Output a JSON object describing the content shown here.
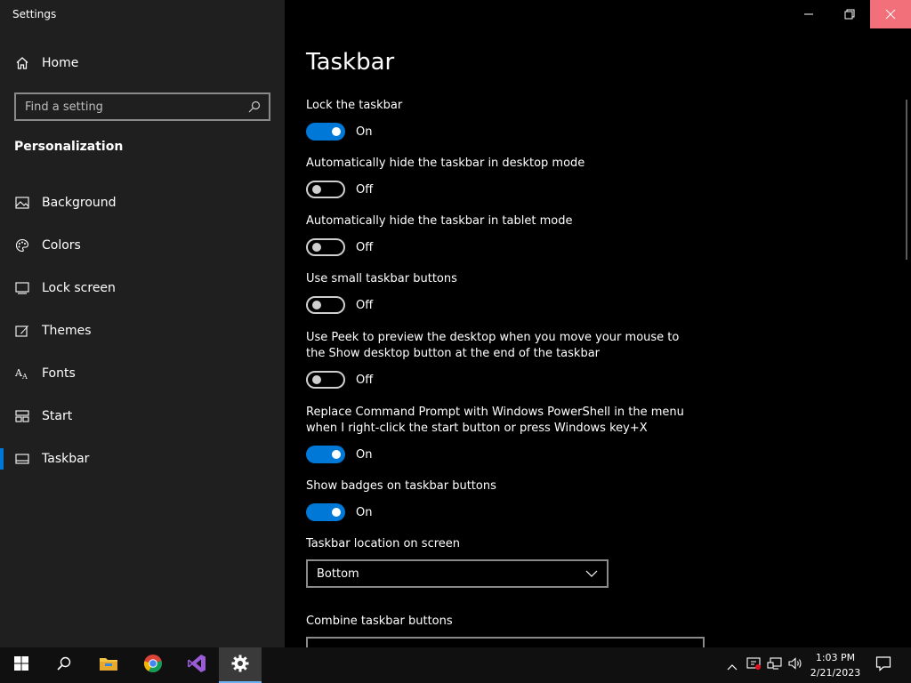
{
  "window": {
    "app_title": "Settings",
    "minimize_icon": "minimize-icon",
    "maximize_icon": "restore-icon",
    "close_icon": "close-icon",
    "close_hover_color": "#f1707a"
  },
  "sidebar": {
    "home_label": "Home",
    "search_placeholder": "Find a setting",
    "section_title": "Personalization",
    "items": [
      {
        "label": "Background",
        "icon": "picture-icon"
      },
      {
        "label": "Colors",
        "icon": "palette-icon"
      },
      {
        "label": "Lock screen",
        "icon": "lock-screen-icon"
      },
      {
        "label": "Themes",
        "icon": "themes-icon"
      },
      {
        "label": "Fonts",
        "icon": "fonts-icon"
      },
      {
        "label": "Start",
        "icon": "start-icon"
      },
      {
        "label": "Taskbar",
        "icon": "taskbar-icon",
        "active": true
      }
    ]
  },
  "main": {
    "title": "Taskbar",
    "settings": [
      {
        "label": "Lock the taskbar",
        "state": "On"
      },
      {
        "label": "Automatically hide the taskbar in desktop mode",
        "state": "Off"
      },
      {
        "label": "Automatically hide the taskbar in tablet mode",
        "state": "Off"
      },
      {
        "label": "Use small taskbar buttons",
        "state": "Off"
      },
      {
        "label": "Use Peek to preview the desktop when you move your mouse to the Show desktop button at the end of the taskbar",
        "state": "Off"
      },
      {
        "label": "Replace Command Prompt with Windows PowerShell in the menu when I right-click the start button or press Windows key+X",
        "state": "On"
      },
      {
        "label": "Show badges on taskbar buttons",
        "state": "On"
      }
    ],
    "location_label": "Taskbar location on screen",
    "location_value": "Bottom",
    "combine_label": "Combine taskbar buttons"
  },
  "taskbar": {
    "apps": [
      "windows-start-icon",
      "search-icon",
      "file-explorer-icon",
      "chrome-icon",
      "visual-studio-icon",
      "settings-gear-icon"
    ],
    "tray": [
      "chevron-up-icon",
      "defender-icon",
      "network-icon",
      "volume-icon"
    ],
    "time": "1:03 PM",
    "date": "2/21/2023",
    "notification_icon": "action-center-icon"
  },
  "colors": {
    "accent": "#0078d7",
    "sidebar_bg": "#1f1f1f",
    "main_bg": "#000000",
    "taskbar_bg": "#101010"
  }
}
